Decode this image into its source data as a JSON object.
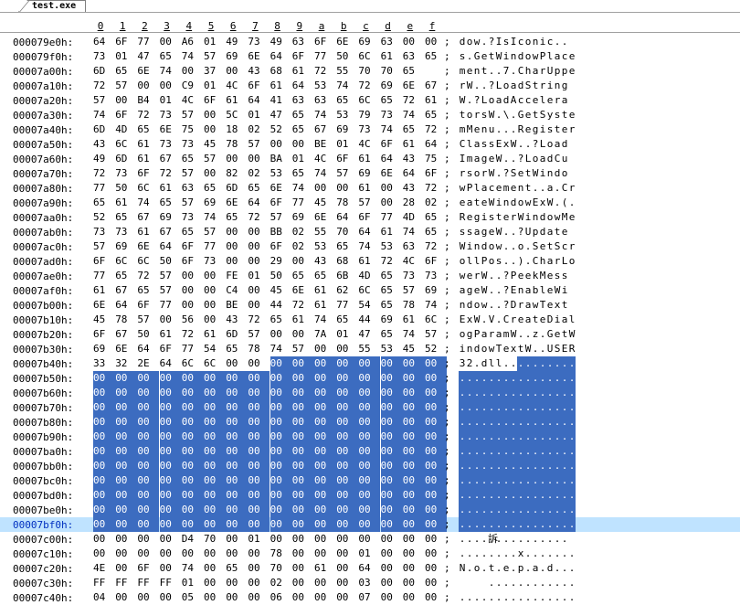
{
  "tab": {
    "label": "test.exe"
  },
  "columns": [
    "0",
    "1",
    "2",
    "3",
    "4",
    "5",
    "6",
    "7",
    "8",
    "9",
    "a",
    "b",
    "c",
    "d",
    "e",
    "f"
  ],
  "separator": ";",
  "rows": [
    {
      "addr": "000079e0h:",
      "bytes": [
        "64",
        "6F",
        "77",
        "00",
        "A6",
        "01",
        "49",
        "73",
        "49",
        "63",
        "6F",
        "6E",
        "69",
        "63",
        "00",
        "00"
      ],
      "ascii": "dow.?IsIconic..",
      "sel_start": -1,
      "cursor": false
    },
    {
      "addr": "000079f0h:",
      "bytes": [
        "73",
        "01",
        "47",
        "65",
        "74",
        "57",
        "69",
        "6E",
        "64",
        "6F",
        "77",
        "50",
        "6C",
        "61",
        "63",
        "65"
      ],
      "ascii": "s.GetWindowPlace",
      "sel_start": -1,
      "cursor": false
    },
    {
      "addr": "00007a00h:",
      "bytes": [
        "6D",
        "65",
        "6E",
        "74",
        "00",
        "37",
        "00",
        "43",
        "68",
        "61",
        "72",
        "55",
        "70",
        "70",
        "65"
      ],
      "ascii": "ment..7.CharUppe",
      "sel_start": -1,
      "cursor": false
    },
    {
      "addr": "00007a10h:",
      "bytes": [
        "72",
        "57",
        "00",
        "00",
        "C9",
        "01",
        "4C",
        "6F",
        "61",
        "64",
        "53",
        "74",
        "72",
        "69",
        "6E",
        "67"
      ],
      "ascii": "rW..?LoadString",
      "sel_start": -1,
      "cursor": false
    },
    {
      "addr": "00007a20h:",
      "bytes": [
        "57",
        "00",
        "B4",
        "01",
        "4C",
        "6F",
        "61",
        "64",
        "41",
        "63",
        "63",
        "65",
        "6C",
        "65",
        "72",
        "61"
      ],
      "ascii": "W.?LoadAccelera",
      "sel_start": -1,
      "cursor": false
    },
    {
      "addr": "00007a30h:",
      "bytes": [
        "74",
        "6F",
        "72",
        "73",
        "57",
        "00",
        "5C",
        "01",
        "47",
        "65",
        "74",
        "53",
        "79",
        "73",
        "74",
        "65"
      ],
      "ascii": "torsW.\\.GetSyste",
      "sel_start": -1,
      "cursor": false
    },
    {
      "addr": "00007a40h:",
      "bytes": [
        "6D",
        "4D",
        "65",
        "6E",
        "75",
        "00",
        "18",
        "02",
        "52",
        "65",
        "67",
        "69",
        "73",
        "74",
        "65",
        "72"
      ],
      "ascii": "mMenu...Register",
      "sel_start": -1,
      "cursor": false
    },
    {
      "addr": "00007a50h:",
      "bytes": [
        "43",
        "6C",
        "61",
        "73",
        "73",
        "45",
        "78",
        "57",
        "00",
        "00",
        "BE",
        "01",
        "4C",
        "6F",
        "61",
        "64"
      ],
      "ascii": "ClassExW..?Load",
      "sel_start": -1,
      "cursor": false
    },
    {
      "addr": "00007a60h:",
      "bytes": [
        "49",
        "6D",
        "61",
        "67",
        "65",
        "57",
        "00",
        "00",
        "BA",
        "01",
        "4C",
        "6F",
        "61",
        "64",
        "43",
        "75"
      ],
      "ascii": "ImageW..?LoadCu",
      "sel_start": -1,
      "cursor": false
    },
    {
      "addr": "00007a70h:",
      "bytes": [
        "72",
        "73",
        "6F",
        "72",
        "57",
        "00",
        "82",
        "02",
        "53",
        "65",
        "74",
        "57",
        "69",
        "6E",
        "64",
        "6F"
      ],
      "ascii": "rsorW.?SetWindo",
      "sel_start": -1,
      "cursor": false
    },
    {
      "addr": "00007a80h:",
      "bytes": [
        "77",
        "50",
        "6C",
        "61",
        "63",
        "65",
        "6D",
        "65",
        "6E",
        "74",
        "00",
        "00",
        "61",
        "00",
        "43",
        "72"
      ],
      "ascii": "wPlacement..a.Cr",
      "sel_start": -1,
      "cursor": false
    },
    {
      "addr": "00007a90h:",
      "bytes": [
        "65",
        "61",
        "74",
        "65",
        "57",
        "69",
        "6E",
        "64",
        "6F",
        "77",
        "45",
        "78",
        "57",
        "00",
        "28",
        "02"
      ],
      "ascii": "eateWindowExW.(.",
      "sel_start": -1,
      "cursor": false
    },
    {
      "addr": "00007aa0h:",
      "bytes": [
        "52",
        "65",
        "67",
        "69",
        "73",
        "74",
        "65",
        "72",
        "57",
        "69",
        "6E",
        "64",
        "6F",
        "77",
        "4D",
        "65"
      ],
      "ascii": "RegisterWindowMe",
      "sel_start": -1,
      "cursor": false
    },
    {
      "addr": "00007ab0h:",
      "bytes": [
        "73",
        "73",
        "61",
        "67",
        "65",
        "57",
        "00",
        "00",
        "BB",
        "02",
        "55",
        "70",
        "64",
        "61",
        "74",
        "65"
      ],
      "ascii": "ssageW..?Update",
      "sel_start": -1,
      "cursor": false
    },
    {
      "addr": "00007ac0h:",
      "bytes": [
        "57",
        "69",
        "6E",
        "64",
        "6F",
        "77",
        "00",
        "00",
        "6F",
        "02",
        "53",
        "65",
        "74",
        "53",
        "63",
        "72"
      ],
      "ascii": "Window..o.SetScr",
      "sel_start": -1,
      "cursor": false
    },
    {
      "addr": "00007ad0h:",
      "bytes": [
        "6F",
        "6C",
        "6C",
        "50",
        "6F",
        "73",
        "00",
        "00",
        "29",
        "00",
        "43",
        "68",
        "61",
        "72",
        "4C",
        "6F"
      ],
      "ascii": "ollPos..).CharLo",
      "sel_start": -1,
      "cursor": false
    },
    {
      "addr": "00007ae0h:",
      "bytes": [
        "77",
        "65",
        "72",
        "57",
        "00",
        "00",
        "FE",
        "01",
        "50",
        "65",
        "65",
        "6B",
        "4D",
        "65",
        "73",
        "73"
      ],
      "ascii": "werW..?PeekMess",
      "sel_start": -1,
      "cursor": false
    },
    {
      "addr": "00007af0h:",
      "bytes": [
        "61",
        "67",
        "65",
        "57",
        "00",
        "00",
        "C4",
        "00",
        "45",
        "6E",
        "61",
        "62",
        "6C",
        "65",
        "57",
        "69"
      ],
      "ascii": "ageW..?EnableWi",
      "sel_start": -1,
      "cursor": false
    },
    {
      "addr": "00007b00h:",
      "bytes": [
        "6E",
        "64",
        "6F",
        "77",
        "00",
        "00",
        "BE",
        "00",
        "44",
        "72",
        "61",
        "77",
        "54",
        "65",
        "78",
        "74"
      ],
      "ascii": "ndow..?DrawText",
      "sel_start": -1,
      "cursor": false
    },
    {
      "addr": "00007b10h:",
      "bytes": [
        "45",
        "78",
        "57",
        "00",
        "56",
        "00",
        "43",
        "72",
        "65",
        "61",
        "74",
        "65",
        "44",
        "69",
        "61",
        "6C"
      ],
      "ascii": "ExW.V.CreateDial",
      "sel_start": -1,
      "cursor": false
    },
    {
      "addr": "00007b20h:",
      "bytes": [
        "6F",
        "67",
        "50",
        "61",
        "72",
        "61",
        "6D",
        "57",
        "00",
        "00",
        "7A",
        "01",
        "47",
        "65",
        "74",
        "57"
      ],
      "ascii": "ogParamW..z.GetW",
      "sel_start": -1,
      "cursor": false
    },
    {
      "addr": "00007b30h:",
      "bytes": [
        "69",
        "6E",
        "64",
        "6F",
        "77",
        "54",
        "65",
        "78",
        "74",
        "57",
        "00",
        "00",
        "55",
        "53",
        "45",
        "52"
      ],
      "ascii": "indowTextW..USER",
      "sel_start": -1,
      "cursor": false
    },
    {
      "addr": "00007b40h:",
      "bytes": [
        "33",
        "32",
        "2E",
        "64",
        "6C",
        "6C",
        "00",
        "00",
        "00",
        "00",
        "00",
        "00",
        "00",
        "00",
        "00",
        "00"
      ],
      "ascii": "32.dll..........",
      "sel_start": 8,
      "cursor": false
    },
    {
      "addr": "00007b50h:",
      "bytes": [
        "00",
        "00",
        "00",
        "00",
        "00",
        "00",
        "00",
        "00",
        "00",
        "00",
        "00",
        "00",
        "00",
        "00",
        "00",
        "00"
      ],
      "ascii": "................",
      "sel_start": 0,
      "cursor": false
    },
    {
      "addr": "00007b60h:",
      "bytes": [
        "00",
        "00",
        "00",
        "00",
        "00",
        "00",
        "00",
        "00",
        "00",
        "00",
        "00",
        "00",
        "00",
        "00",
        "00",
        "00"
      ],
      "ascii": "................",
      "sel_start": 0,
      "cursor": false
    },
    {
      "addr": "00007b70h:",
      "bytes": [
        "00",
        "00",
        "00",
        "00",
        "00",
        "00",
        "00",
        "00",
        "00",
        "00",
        "00",
        "00",
        "00",
        "00",
        "00",
        "00"
      ],
      "ascii": "................",
      "sel_start": 0,
      "cursor": false
    },
    {
      "addr": "00007b80h:",
      "bytes": [
        "00",
        "00",
        "00",
        "00",
        "00",
        "00",
        "00",
        "00",
        "00",
        "00",
        "00",
        "00",
        "00",
        "00",
        "00",
        "00"
      ],
      "ascii": "................",
      "sel_start": 0,
      "cursor": false
    },
    {
      "addr": "00007b90h:",
      "bytes": [
        "00",
        "00",
        "00",
        "00",
        "00",
        "00",
        "00",
        "00",
        "00",
        "00",
        "00",
        "00",
        "00",
        "00",
        "00",
        "00"
      ],
      "ascii": "................",
      "sel_start": 0,
      "cursor": false
    },
    {
      "addr": "00007ba0h:",
      "bytes": [
        "00",
        "00",
        "00",
        "00",
        "00",
        "00",
        "00",
        "00",
        "00",
        "00",
        "00",
        "00",
        "00",
        "00",
        "00",
        "00"
      ],
      "ascii": "................",
      "sel_start": 0,
      "cursor": false
    },
    {
      "addr": "00007bb0h:",
      "bytes": [
        "00",
        "00",
        "00",
        "00",
        "00",
        "00",
        "00",
        "00",
        "00",
        "00",
        "00",
        "00",
        "00",
        "00",
        "00",
        "00"
      ],
      "ascii": "................",
      "sel_start": 0,
      "cursor": false
    },
    {
      "addr": "00007bc0h:",
      "bytes": [
        "00",
        "00",
        "00",
        "00",
        "00",
        "00",
        "00",
        "00",
        "00",
        "00",
        "00",
        "00",
        "00",
        "00",
        "00",
        "00"
      ],
      "ascii": "................",
      "sel_start": 0,
      "cursor": false
    },
    {
      "addr": "00007bd0h:",
      "bytes": [
        "00",
        "00",
        "00",
        "00",
        "00",
        "00",
        "00",
        "00",
        "00",
        "00",
        "00",
        "00",
        "00",
        "00",
        "00",
        "00"
      ],
      "ascii": "................",
      "sel_start": 0,
      "cursor": false
    },
    {
      "addr": "00007be0h:",
      "bytes": [
        "00",
        "00",
        "00",
        "00",
        "00",
        "00",
        "00",
        "00",
        "00",
        "00",
        "00",
        "00",
        "00",
        "00",
        "00",
        "00"
      ],
      "ascii": "................",
      "sel_start": 0,
      "cursor": false
    },
    {
      "addr": "00007bf0h:",
      "bytes": [
        "00",
        "00",
        "00",
        "00",
        "00",
        "00",
        "00",
        "00",
        "00",
        "00",
        "00",
        "00",
        "00",
        "00",
        "00",
        "00"
      ],
      "ascii": "................",
      "sel_start": 0,
      "cursor": true
    },
    {
      "addr": "00007c00h:",
      "bytes": [
        "00",
        "00",
        "00",
        "00",
        "D4",
        "70",
        "00",
        "01",
        "00",
        "00",
        "00",
        "00",
        "00",
        "00",
        "00",
        "00"
      ],
      "ascii": "....訴..........",
      "sel_start": -1,
      "cursor": false
    },
    {
      "addr": "00007c10h:",
      "bytes": [
        "00",
        "00",
        "00",
        "00",
        "00",
        "00",
        "00",
        "00",
        "78",
        "00",
        "00",
        "00",
        "01",
        "00",
        "00",
        "00"
      ],
      "ascii": "........x.......",
      "sel_start": -1,
      "cursor": false
    },
    {
      "addr": "00007c20h:",
      "bytes": [
        "4E",
        "00",
        "6F",
        "00",
        "74",
        "00",
        "65",
        "00",
        "70",
        "00",
        "61",
        "00",
        "64",
        "00",
        "00",
        "00"
      ],
      "ascii": "N.o.t.e.p.a.d...",
      "sel_start": -1,
      "cursor": false
    },
    {
      "addr": "00007c30h:",
      "bytes": [
        "FF",
        "FF",
        "FF",
        "FF",
        "01",
        "00",
        "00",
        "00",
        "02",
        "00",
        "00",
        "00",
        "03",
        "00",
        "00",
        "00"
      ],
      "ascii": "    ............",
      "sel_start": -1,
      "cursor": false
    },
    {
      "addr": "00007c40h:",
      "bytes": [
        "04",
        "00",
        "00",
        "00",
        "05",
        "00",
        "00",
        "00",
        "06",
        "00",
        "00",
        "00",
        "07",
        "00",
        "00",
        "00"
      ],
      "ascii": "................",
      "sel_start": -1,
      "cursor": false
    }
  ],
  "colors": {
    "selection": "#3c6cc0",
    "cursor_row": "#bfe3ff",
    "cursor_addr": "#0030c0"
  }
}
